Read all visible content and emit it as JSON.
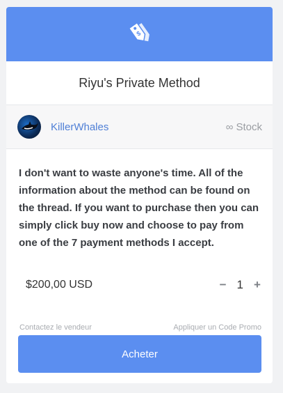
{
  "product": {
    "title": "Riyu's Private Method",
    "banner_icon": "price-tag-icon"
  },
  "seller": {
    "name": "KillerWhales",
    "avatar_icon": "killer-whale-avatar",
    "stock_label": "Stock",
    "stock_icon": "infinity-icon"
  },
  "description": "I don't want to waste anyone's time. All of the information about the method can be found on the thread. If you want to purchase then you can simply click buy now and choose to pay from one of the 7 payment methods I accept.",
  "purchase": {
    "price": "$200,00 USD",
    "quantity": "1",
    "decrement_symbol": "−",
    "increment_symbol": "+"
  },
  "links": {
    "contact": "Contactez le vendeur",
    "promo": "Appliquer un Code Promo"
  },
  "buy_button_label": "Acheter",
  "colors": {
    "accent": "#5b8ef0",
    "seller_link": "#4f7fd6"
  }
}
